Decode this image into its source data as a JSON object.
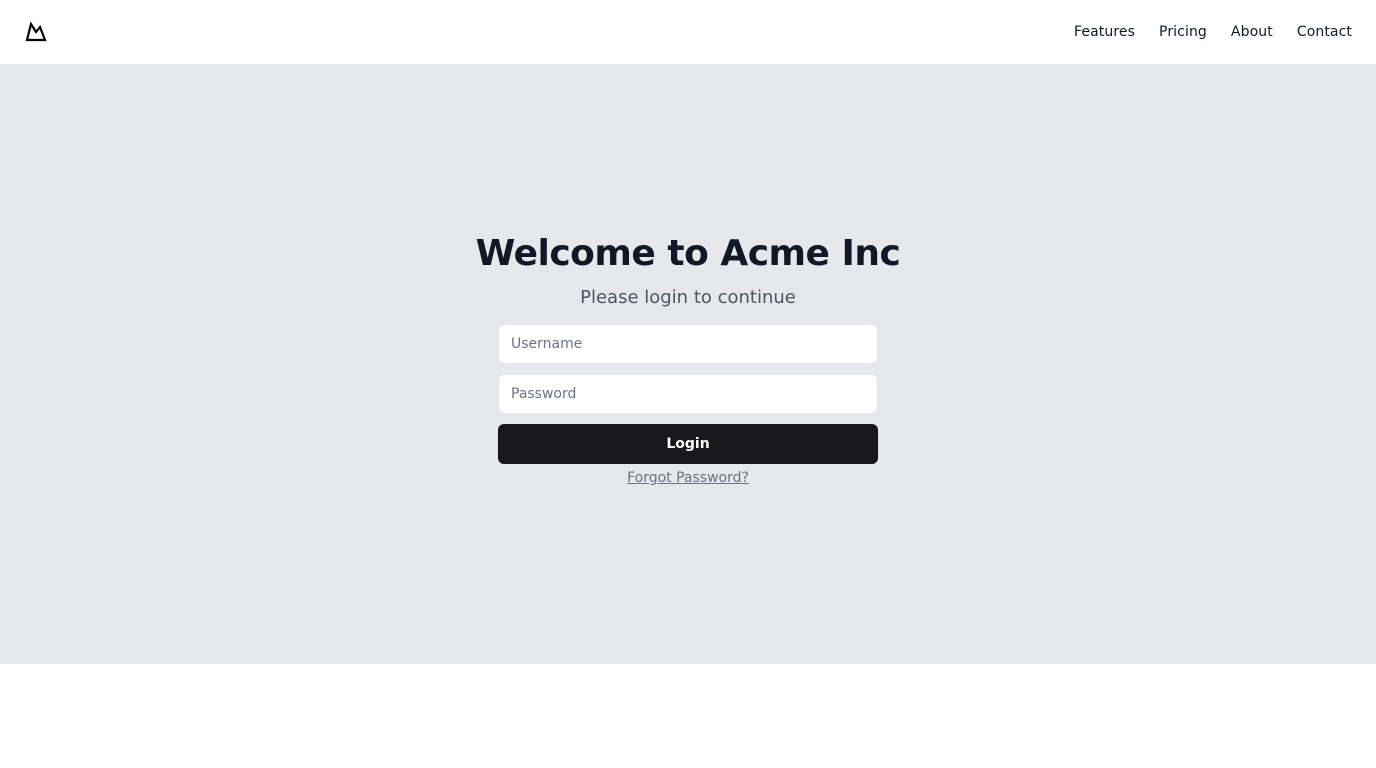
{
  "header": {
    "logo_icon": "mountain-icon",
    "nav": [
      {
        "label": "Features"
      },
      {
        "label": "Pricing"
      },
      {
        "label": "About"
      },
      {
        "label": "Contact"
      }
    ]
  },
  "login": {
    "title": "Welcome to Acme Inc",
    "subtitle": "Please login to continue",
    "username_placeholder": "Username",
    "password_placeholder": "Password",
    "button_label": "Login",
    "forgot_label": "Forgot Password?"
  },
  "colors": {
    "hero_bg": "#e5e7eb",
    "button_bg": "#18181b",
    "title": "#111827",
    "subtitle": "#4b5563",
    "link": "#6b7280"
  }
}
